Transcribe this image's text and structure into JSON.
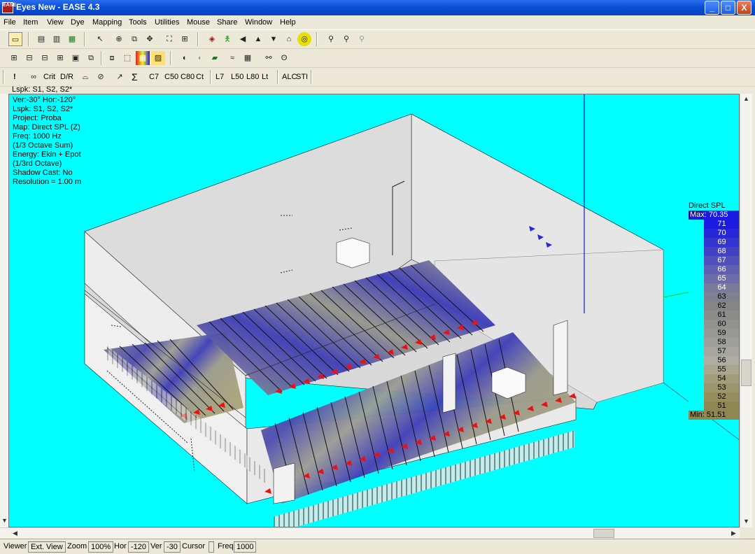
{
  "window": {
    "title": "Eyes New - EASE 4.3",
    "icon_text": "EASE",
    "minimize_label": "_",
    "maximize_label": "□",
    "close_label": "X"
  },
  "menu": [
    "File",
    "Item",
    "View",
    "Dye",
    "Mapping",
    "Tools",
    "Utilities",
    "Mouse",
    "Share",
    "Window",
    "Help"
  ],
  "toolbar3": {
    "exclaim": "!",
    "crit": "Crit",
    "dr": "D/R",
    "sigma": "Σ",
    "c7": "C7",
    "c50": "C50",
    "c80": "C80",
    "ct": "Ct",
    "l7": "L7",
    "l50": "L50",
    "l80": "L80",
    "lt": "Lt",
    "alc": "ALC",
    "sti": "STI"
  },
  "info_top": "Lspk: S1, S2, S2*",
  "info_panel": [
    "Ver:-30°   Hor:-120°",
    "Lspk: S1, S2, S2*",
    "Project: Proba",
    "Map: Direct SPL (Z)",
    "Freq: 1000 Hz",
    "(1/3 Octave Sum)",
    "Energy: Ekin + Epot",
    "(1/3rd Octave)",
    "Shadow Cast: No",
    "Resolution =   1.00 m"
  ],
  "legend": {
    "title": "Direct SPL [dB]",
    "max_label": "Max:  70.35",
    "min_label": "Min:  51.51",
    "rows": [
      {
        "label": "71",
        "color": "#1a1ae0"
      },
      {
        "label": "70",
        "color": "#2727d8"
      },
      {
        "label": "69",
        "color": "#3434d0"
      },
      {
        "label": "68",
        "color": "#4242c6"
      },
      {
        "label": "67",
        "color": "#5050bc"
      },
      {
        "label": "66",
        "color": "#5e5eb2"
      },
      {
        "label": "65",
        "color": "#6c6ca8"
      },
      {
        "label": "64",
        "color": "#7a7a9a"
      },
      {
        "label": "63",
        "color": "#808090"
      },
      {
        "label": "62",
        "color": "#868688"
      },
      {
        "label": "61",
        "color": "#8c8c8a"
      },
      {
        "label": "60",
        "color": "#929290"
      },
      {
        "label": "59",
        "color": "#989896"
      },
      {
        "label": "58",
        "color": "#9e9e9a"
      },
      {
        "label": "57",
        "color": "#a6a69e"
      },
      {
        "label": "56",
        "color": "#aeaea2"
      },
      {
        "label": "55",
        "color": "#a8a68c"
      },
      {
        "label": "54",
        "color": "#a29e7c"
      },
      {
        "label": "53",
        "color": "#9c966c"
      },
      {
        "label": "52",
        "color": "#968e5e"
      },
      {
        "label": "51",
        "color": "#908652"
      }
    ]
  },
  "status": {
    "viewer": "Viewer",
    "ext_view": "Ext. View",
    "zoom_label": "Zoom",
    "zoom_value": "100%",
    "hor_label": "Hor",
    "hor_value": "-120",
    "ver_label": "Ver",
    "ver_value": "-30",
    "cursor_label": "Cursor",
    "freq_label": "Freq",
    "freq_value": "1000"
  }
}
